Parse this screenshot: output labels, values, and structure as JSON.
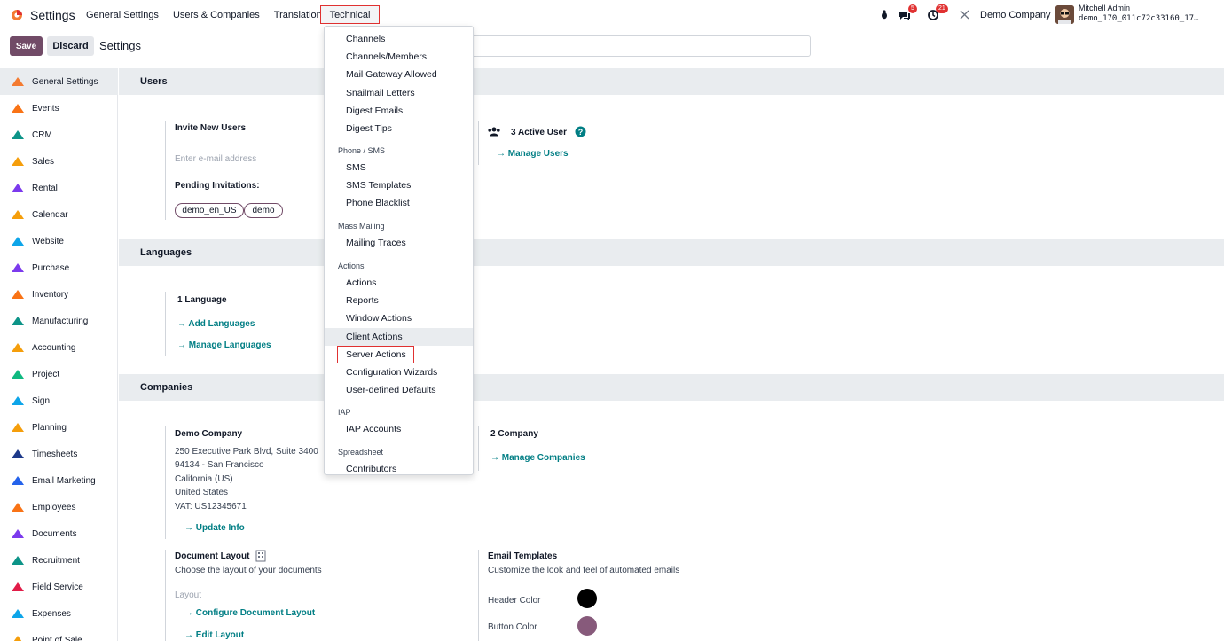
{
  "app": {
    "title": "Settings"
  },
  "top_menu": [
    "General Settings",
    "Users & Companies",
    "Translations"
  ],
  "technical_menu_label": "Technical",
  "systray": {
    "messages_badge": "5",
    "activity_badge": "21",
    "company": "Demo Company",
    "user_name": "Mitchell Admin",
    "user_db": "demo_170_011c72c33160_17…"
  },
  "control_panel": {
    "save": "Save",
    "discard": "Discard",
    "title": "Settings"
  },
  "sidebar": [
    {
      "label": "General Settings",
      "icon": "odoo-icon",
      "color": "#f47b31",
      "active": true
    },
    {
      "label": "Events",
      "icon": "events-icon",
      "color": "#f97316"
    },
    {
      "label": "CRM",
      "icon": "crm-icon",
      "color": "#0d9488"
    },
    {
      "label": "Sales",
      "icon": "sales-icon",
      "color": "#f59e0b"
    },
    {
      "label": "Rental",
      "icon": "rental-icon",
      "color": "#7c3aed"
    },
    {
      "label": "Calendar",
      "icon": "calendar-icon",
      "color": "#f59e0b"
    },
    {
      "label": "Website",
      "icon": "website-icon",
      "color": "#0ea5e9"
    },
    {
      "label": "Purchase",
      "icon": "purchase-icon",
      "color": "#7c3aed"
    },
    {
      "label": "Inventory",
      "icon": "inventory-icon",
      "color": "#f97316"
    },
    {
      "label": "Manufacturing",
      "icon": "manufacturing-icon",
      "color": "#0d9488"
    },
    {
      "label": "Accounting",
      "icon": "accounting-icon",
      "color": "#f59e0b"
    },
    {
      "label": "Project",
      "icon": "project-icon",
      "color": "#10b981"
    },
    {
      "label": "Sign",
      "icon": "sign-icon",
      "color": "#0ea5e9"
    },
    {
      "label": "Planning",
      "icon": "planning-icon",
      "color": "#f59e0b"
    },
    {
      "label": "Timesheets",
      "icon": "timesheets-icon",
      "color": "#1e3a8a"
    },
    {
      "label": "Email Marketing",
      "icon": "email-marketing-icon",
      "color": "#2563eb"
    },
    {
      "label": "Employees",
      "icon": "employees-icon",
      "color": "#f97316"
    },
    {
      "label": "Documents",
      "icon": "documents-icon",
      "color": "#7c3aed"
    },
    {
      "label": "Recruitment",
      "icon": "recruitment-icon",
      "color": "#0d9488"
    },
    {
      "label": "Field Service",
      "icon": "field-service-icon",
      "color": "#e11d48"
    },
    {
      "label": "Expenses",
      "icon": "expenses-icon",
      "color": "#0ea5e9"
    },
    {
      "label": "Point of Sale",
      "icon": "pos-icon",
      "color": "#f59e0b"
    }
  ],
  "sections": {
    "users": "Users",
    "languages": "Languages",
    "companies": "Companies"
  },
  "users": {
    "invite_label": "Invite New Users",
    "email_placeholder": "Enter e-mail address",
    "pending_label": "Pending Invitations:",
    "pending_tags": [
      "demo_en_US",
      "demo"
    ],
    "active_users": "3 Active User",
    "manage_users": "Manage Users"
  },
  "languages": {
    "count": "1 Language",
    "add": "Add Languages",
    "manage": "Manage Languages"
  },
  "companies": {
    "name": "Demo Company",
    "address_lines": [
      "250 Executive Park Blvd, Suite 3400",
      "94134 - San Francisco",
      "California (US)",
      "United States",
      "VAT:  US12345671"
    ],
    "update_info": "Update Info",
    "count": "2 Company",
    "manage": "Manage Companies",
    "doc_layout_title": "Document Layout",
    "doc_layout_desc": "Choose the layout of your documents",
    "layout_label": "Layout",
    "configure_layout": "Configure Document Layout",
    "edit_layout": "Edit Layout",
    "email_templates_title": "Email Templates",
    "email_templates_desc": "Customize the look and feel of automated emails",
    "header_color_label": "Header Color",
    "header_color": "#000000",
    "button_color_label": "Button Color",
    "button_color": "#875a7b"
  },
  "dropdown": {
    "items_top": [
      "Channels",
      "Channels/Members",
      "Mail Gateway Allowed",
      "Snailmail Letters",
      "Digest Emails",
      "Digest Tips"
    ],
    "phone_header": "Phone / SMS",
    "phone_items": [
      "SMS",
      "SMS Templates",
      "Phone Blacklist"
    ],
    "mass_header": "Mass Mailing",
    "mass_items": [
      "Mailing Traces"
    ],
    "actions_header": "Actions",
    "actions_items": [
      "Actions",
      "Reports",
      "Window Actions",
      "Client Actions",
      "Server Actions",
      "Configuration Wizards",
      "User-defined Defaults"
    ],
    "iap_header": "IAP",
    "iap_items": [
      "IAP Accounts"
    ],
    "spreadsheet_header": "Spreadsheet",
    "spreadsheet_items": [
      "Contributors"
    ]
  }
}
